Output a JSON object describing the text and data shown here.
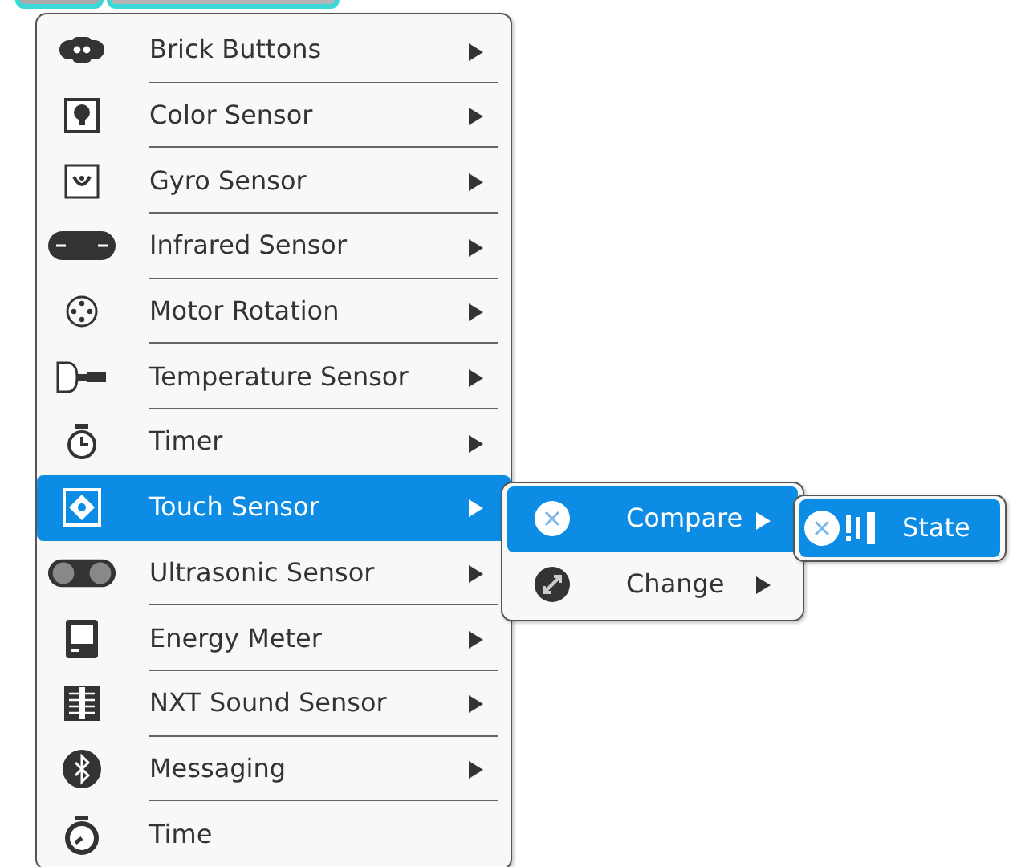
{
  "menu": {
    "items": [
      {
        "label": "Brick Buttons",
        "has_submenu": true,
        "selected": false
      },
      {
        "label": "Color Sensor",
        "has_submenu": true,
        "selected": false
      },
      {
        "label": "Gyro Sensor",
        "has_submenu": true,
        "selected": false
      },
      {
        "label": "Infrared Sensor",
        "has_submenu": true,
        "selected": false
      },
      {
        "label": "Motor Rotation",
        "has_submenu": true,
        "selected": false
      },
      {
        "label": "Temperature Sensor",
        "has_submenu": true,
        "selected": false
      },
      {
        "label": "Timer",
        "has_submenu": true,
        "selected": false
      },
      {
        "label": "Touch Sensor",
        "has_submenu": true,
        "selected": true
      },
      {
        "label": "Ultrasonic Sensor",
        "has_submenu": true,
        "selected": false
      },
      {
        "label": "Energy Meter",
        "has_submenu": true,
        "selected": false
      },
      {
        "label": "NXT Sound Sensor",
        "has_submenu": true,
        "selected": false
      },
      {
        "label": "Messaging",
        "has_submenu": true,
        "selected": false
      },
      {
        "label": "Time",
        "has_submenu": false,
        "selected": false
      }
    ]
  },
  "submenu": {
    "items": [
      {
        "label": "Compare",
        "has_submenu": true,
        "selected": true
      },
      {
        "label": "Change",
        "has_submenu": true,
        "selected": false
      }
    ]
  },
  "submenu_2": {
    "items": [
      {
        "label": "State",
        "has_submenu": false,
        "selected": true
      }
    ]
  }
}
